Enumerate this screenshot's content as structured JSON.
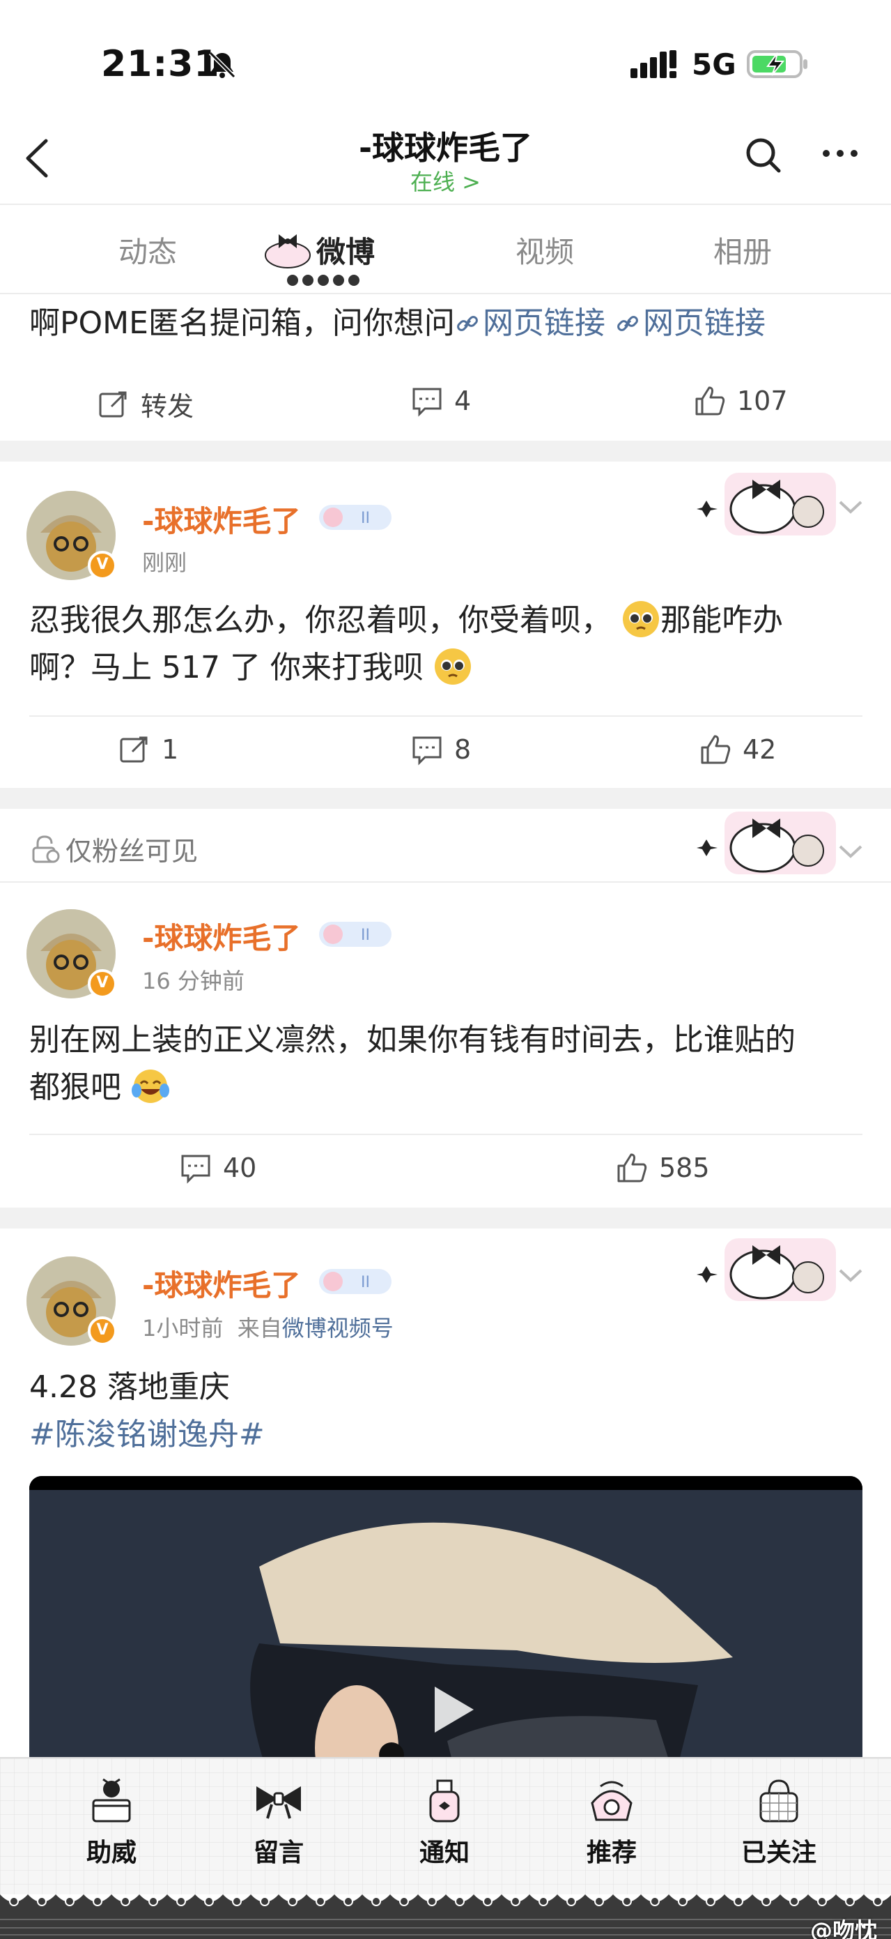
{
  "status": {
    "time": "21:31",
    "network": "5G"
  },
  "nav": {
    "title": "-球球炸毛了",
    "subtitle": "在线 >"
  },
  "tabs": [
    {
      "label": "动态"
    },
    {
      "label": "微博"
    },
    {
      "label": "视频"
    },
    {
      "label": "相册"
    }
  ],
  "post0": {
    "text_prefix": "啊POME匿名提问箱，问你想问",
    "link1": "网页链接",
    "link2": "网页链接",
    "repost": "转发",
    "comments": "4",
    "likes": "107"
  },
  "post1": {
    "username": "-球球炸毛了",
    "time": "刚刚",
    "line1": "忍我很久那怎么办，你忍着呗，你受着呗，",
    "line1b": "那能咋办",
    "line2": "啊？马上 517 了 你来打我呗",
    "reposts": "1",
    "comments": "8",
    "likes": "42"
  },
  "post2": {
    "visibility": "仅粉丝可见",
    "username": "-球球炸毛了",
    "time": "16 分钟前",
    "line1": "别在网上装的正义凛然，如果你有钱有时间去，比谁贴的",
    "line2": "都狠吧",
    "comments": "40",
    "likes": "585"
  },
  "post3": {
    "username": "-球球炸毛了",
    "time": "1小时前",
    "from": "来自",
    "source": "微博视频号",
    "line1": "4.28 落地重庆",
    "hashtag": "#陈浚铭谢逸舟#"
  },
  "bottom_bar": [
    {
      "label": "助威",
      "icon": "cake-icon"
    },
    {
      "label": "留言",
      "icon": "bow-icon"
    },
    {
      "label": "通知",
      "icon": "bottle-icon"
    },
    {
      "label": "推荐",
      "icon": "phone-icon"
    },
    {
      "label": "已关注",
      "icon": "bag-icon"
    }
  ],
  "watermark": "@吻忱",
  "colors": {
    "username": "#e8702a",
    "link": "#4f6f9a",
    "online": "#4caf50",
    "badge": "#f39a1d"
  }
}
